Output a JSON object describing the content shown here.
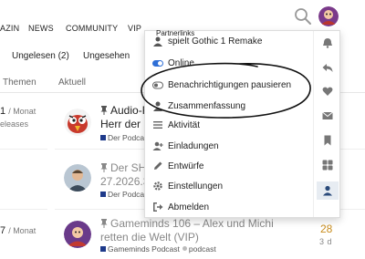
{
  "topnav": {
    "items": [
      "AZIN",
      "NEWS",
      "COMMUNITY",
      "VIP",
      "Partnerlinks"
    ]
  },
  "subnav": {
    "items": [
      "Ungelesen (2)",
      "Ungesehen"
    ]
  },
  "list": {
    "col_themes": "Themen",
    "col_latest": "Aktuell",
    "rows": [
      {
        "cat_count": "1",
        "cat_unit": "/ Monat",
        "cat_desc": "eleases",
        "title_line1": "Audio-R",
        "title_line2": "Herr der E",
        "category": "Der Podcast",
        "category_color": "#1e3a8a"
      },
      {
        "title_line1": "Der SHO",
        "title_line2": "27.2026.3",
        "category": "Der Podcast",
        "category_color": "#1e3a8a"
      },
      {
        "cat_count": "7",
        "cat_unit": "/ Monat",
        "title_line1": "Gameminds 106 – Alex und Michi",
        "title_line2": "retten die Welt (VIP)",
        "category": "Gameminds Podcast",
        "category_color": "#1e3a8a",
        "tag": "podcast",
        "replies": "28",
        "activity": "3 d"
      }
    ]
  },
  "user_menu": {
    "title": "Partnerlinks",
    "items": [
      {
        "label": "spielt Gothic 1 Remake",
        "icon": "user-status-icon"
      },
      {
        "label": "Online",
        "icon": "online-toggle-icon"
      },
      {
        "label": "Benachrichtigungen pausieren",
        "icon": "toggle-off-icon"
      },
      {
        "label": "Zusammenfassung",
        "icon": "summary-icon"
      },
      {
        "label": "Aktivität",
        "icon": "list-icon"
      },
      {
        "label": "Einladungen",
        "icon": "user-plus-icon"
      },
      {
        "label": "Entwürfe",
        "icon": "pencil-icon"
      },
      {
        "label": "Einstellungen",
        "icon": "gear-icon"
      },
      {
        "label": "Abmelden",
        "icon": "sign-out-icon"
      }
    ],
    "rail_icons": [
      "bell-icon",
      "reply-icon",
      "heart-icon",
      "envelope-icon",
      "bookmark-icon",
      "chat-icon",
      "user-icon"
    ]
  },
  "colors": {
    "accent": "#2f6fd6",
    "reply_count": "#c88c1c",
    "category": "#1e3a8a",
    "rail_active": "#e7ecf2"
  }
}
